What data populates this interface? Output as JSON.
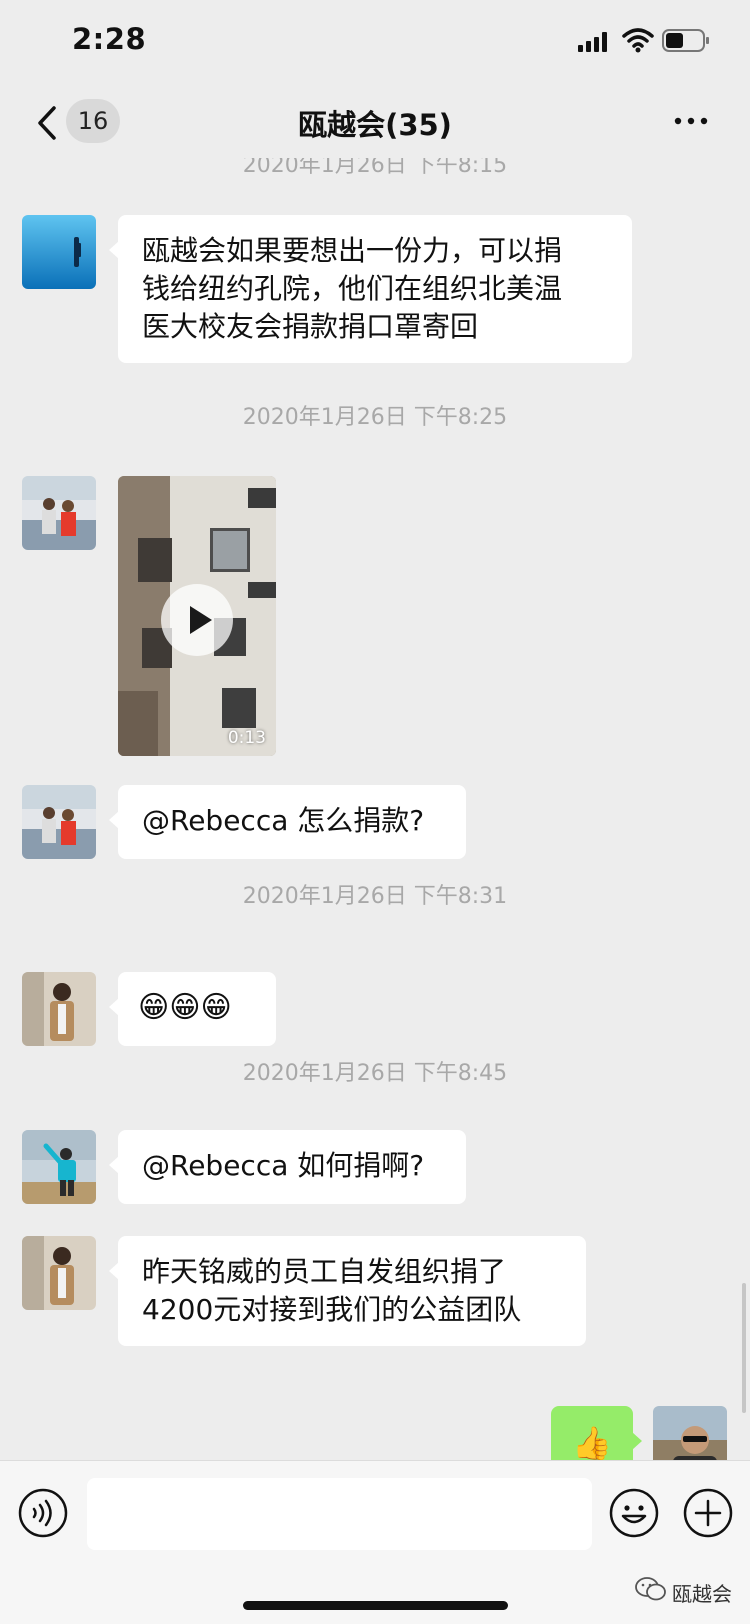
{
  "status_bar": {
    "time": "2:28"
  },
  "nav": {
    "unread_count": "16",
    "title": "瓯越会(35)"
  },
  "messages": [
    {
      "timestamp": "2020年1月26日 下午8:15"
    },
    {
      "text_lines": [
        "瓯越会如果要想出一份力，可以捐",
        "钱给纽约孔院，他们在组织北美温",
        "医大校友会捐款捐口罩寄回"
      ]
    },
    {
      "timestamp": "2020年1月26日 下午8:25"
    },
    {
      "video_duration": "0:13"
    },
    {
      "text": "@Rebecca 怎么捐款?"
    },
    {
      "timestamp": "2020年1月26日 下午8:31"
    },
    {
      "text": "😁😁😁"
    },
    {
      "timestamp": "2020年1月26日 下午8:45"
    },
    {
      "text": "@Rebecca 如何捐啊?"
    },
    {
      "text_lines": [
        "昨天铭威的员工自发组织捐了",
        "4200元对接到我们的公益团队"
      ]
    },
    {
      "text": "👍"
    }
  ],
  "watermark": {
    "text": "瓯越会"
  },
  "icons": {
    "back": "chevron-left-icon",
    "more": "more-dots-icon",
    "voice": "voice-icon",
    "emoji": "emoji-icon",
    "plus": "plus-icon"
  },
  "colors": {
    "background": "#ededed",
    "bubble": "#ffffff",
    "self_bubble": "#95ec69"
  }
}
